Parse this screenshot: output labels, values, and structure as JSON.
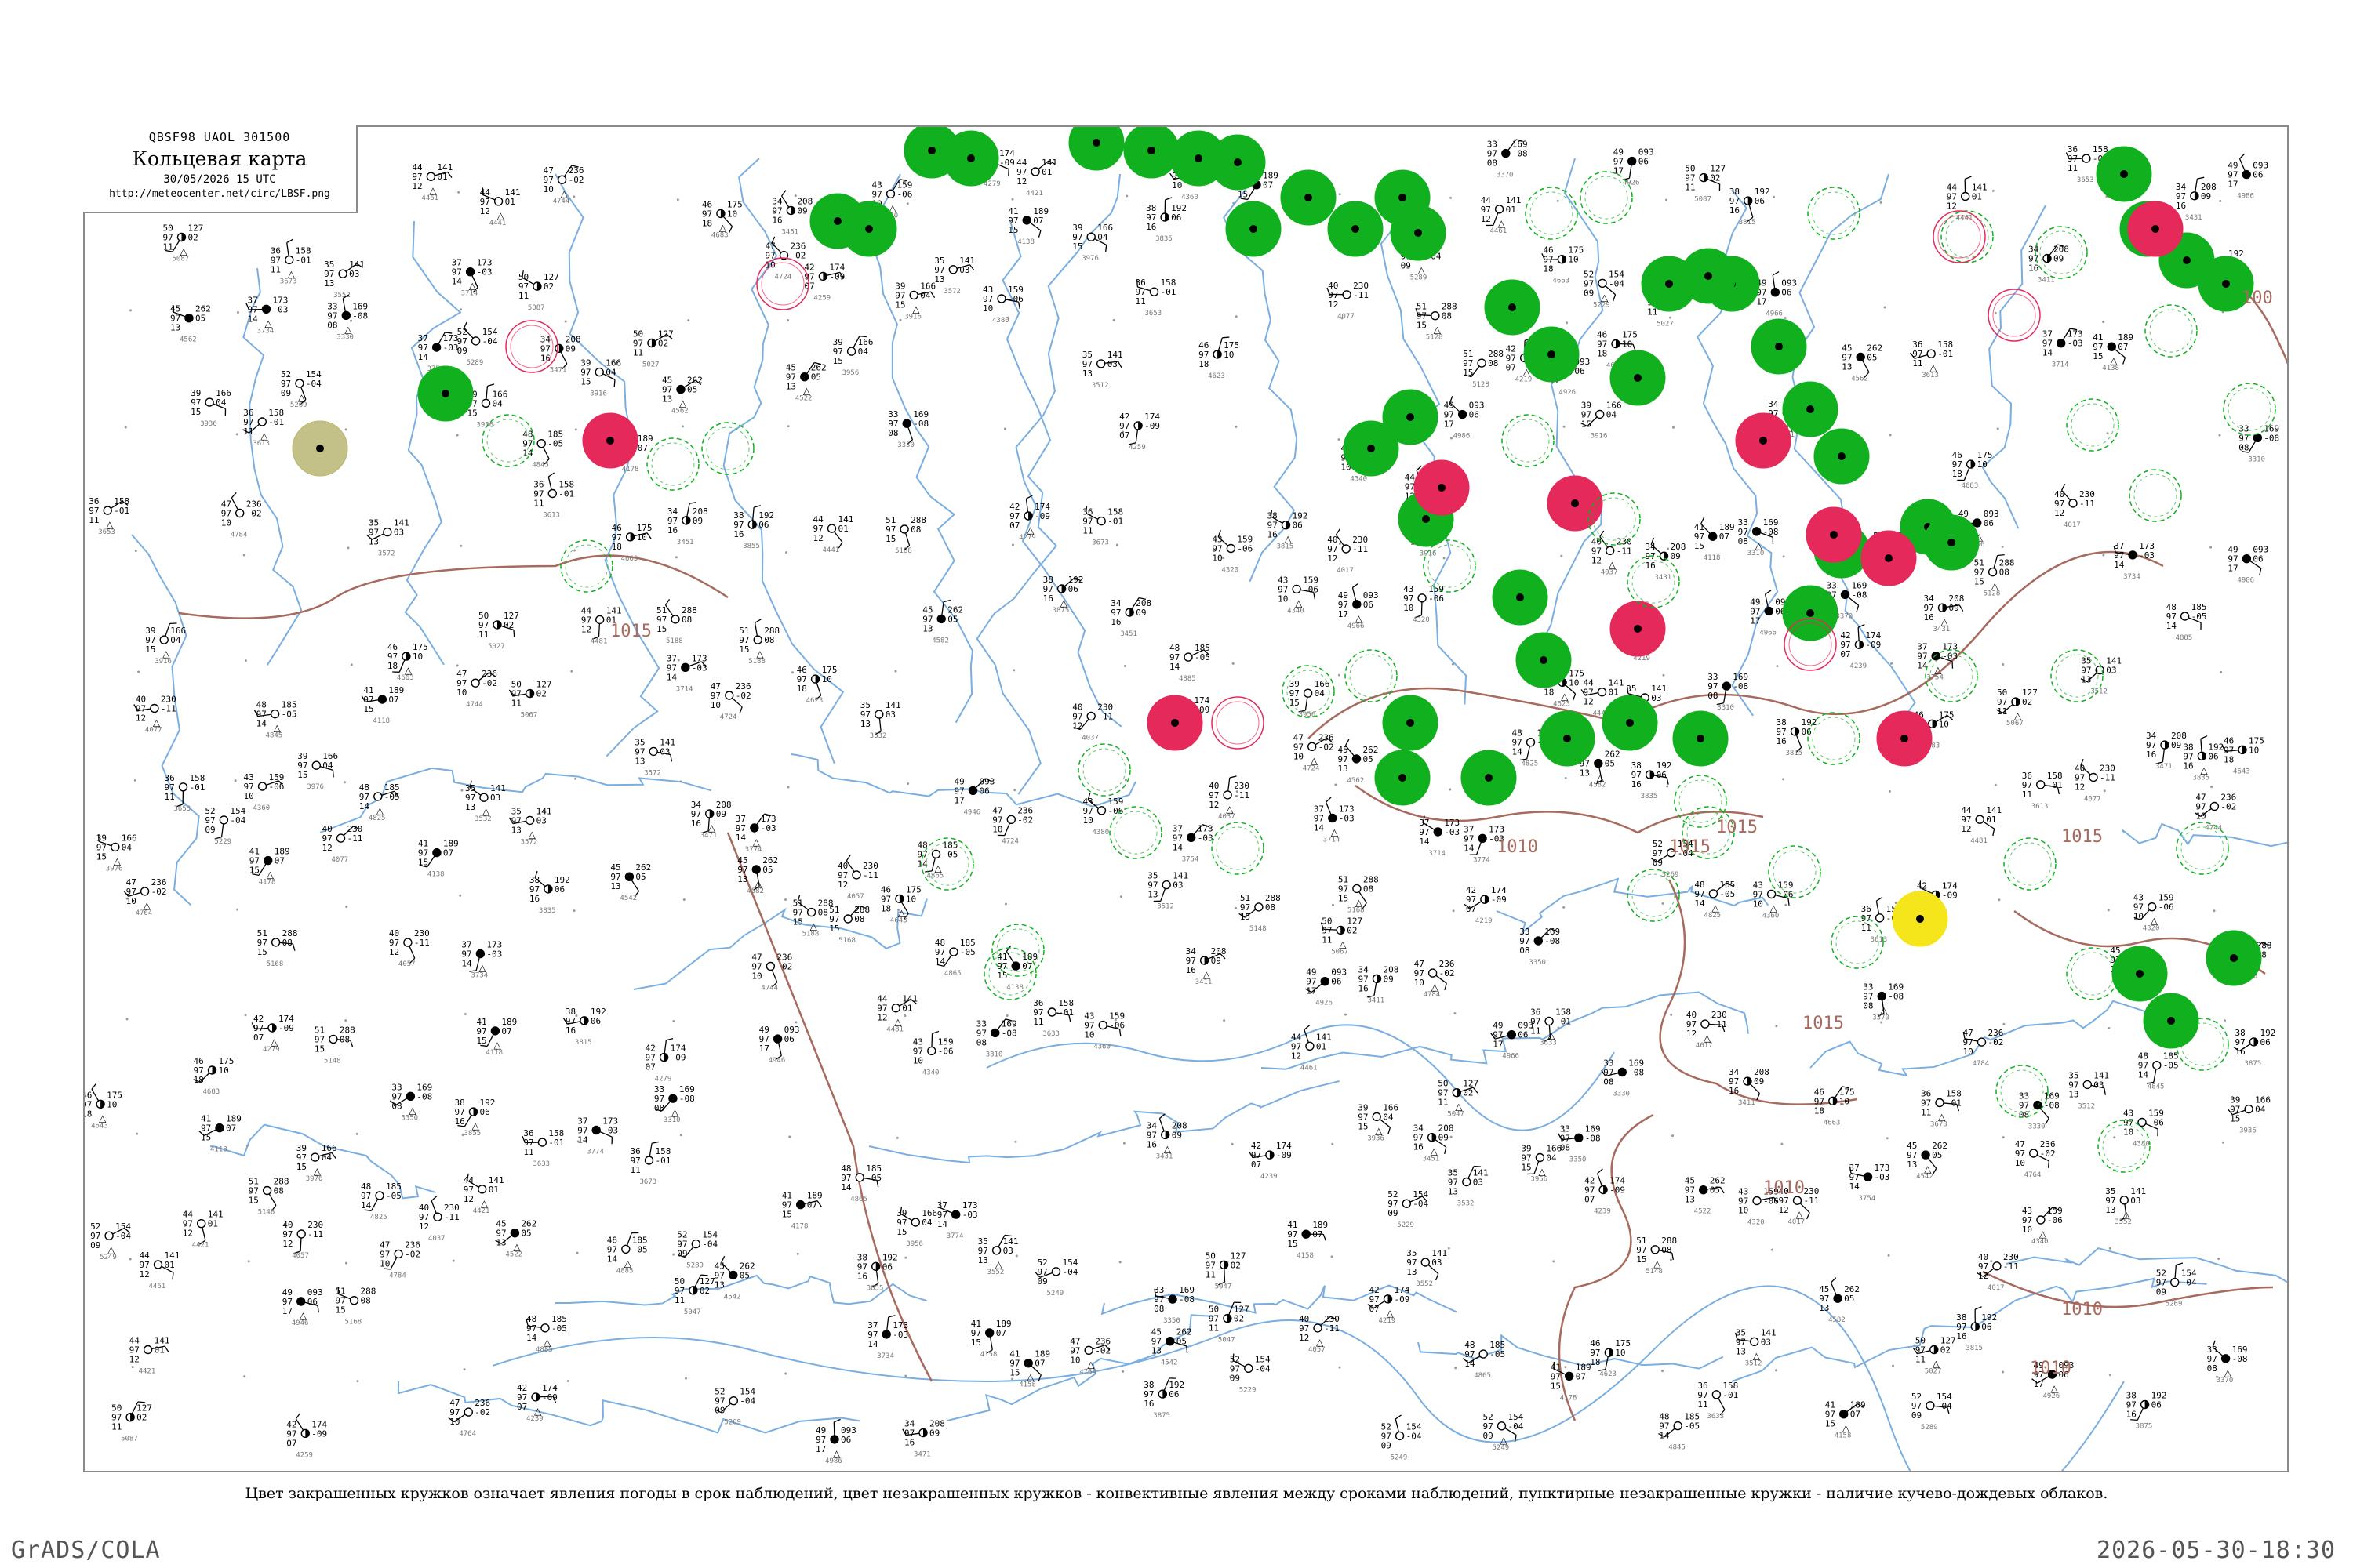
{
  "header": {
    "code_line": "QBSF98  UAOL  301500",
    "title": "Кольцевая карта",
    "datetime": "30/05/2026 15 UTC",
    "url": "http://meteocenter.net/circ/LBSF.png"
  },
  "caption": "Цвет закрашенных кружков означает явления погоды в срок наблюдений, цвет незакрашенных кружков - конвективные явления между сроками наблюдений, пунктирные незакрашенные кружки - наличие кучево-дождевых облаков.",
  "footer": {
    "software": "GrADS/COLA",
    "timestamp": "2026-05-30-18:30"
  },
  "colors": {
    "green": "#11b01f",
    "red": "#e5295a",
    "yellow": "#f5e51b",
    "olive": "#b9b673",
    "isobar": "#a86a5e",
    "water": "#7aaee0",
    "station": "#000000"
  },
  "isobar_labels": [
    "1015",
    "1010",
    "1015",
    "1015",
    "1010",
    "1015",
    "1010",
    "1015",
    "1010",
    "100"
  ],
  "stations": [
    {
      "id": "33",
      "p": "169",
      "t": "08",
      "d": "-08"
    },
    {
      "id": "34",
      "p": "208",
      "t": "16",
      "d": "09"
    },
    {
      "id": "35",
      "p": "141",
      "t": "13",
      "d": "03"
    },
    {
      "id": "36",
      "p": "158",
      "t": "11",
      "d": "-01"
    },
    {
      "id": "37",
      "p": "173",
      "t": "14",
      "d": "-03"
    },
    {
      "id": "38",
      "p": "192",
      "t": "16",
      "d": "06"
    },
    {
      "id": "39",
      "p": "166",
      "t": "15",
      "d": "04"
    },
    {
      "id": "40",
      "p": "230",
      "t": "12",
      "d": "-11"
    },
    {
      "id": "41",
      "p": "189",
      "t": "15",
      "d": "07"
    },
    {
      "id": "42",
      "p": "174",
      "t": "07",
      "d": "-09"
    },
    {
      "id": "43",
      "p": "159",
      "t": "10",
      "d": "-06"
    },
    {
      "id": "44",
      "p": "141",
      "t": "12",
      "d": "01"
    },
    {
      "id": "45",
      "p": "262",
      "t": "13",
      "d": "05"
    },
    {
      "id": "46",
      "p": "175",
      "t": "18",
      "d": "10"
    },
    {
      "id": "47",
      "p": "236",
      "t": "10",
      "d": "-02"
    },
    {
      "id": "48",
      "p": "185",
      "t": "14",
      "d": "-05"
    },
    {
      "id": "49",
      "p": "093",
      "t": "17",
      "d": "06"
    },
    {
      "id": "50",
      "p": "127",
      "t": "11",
      "d": "02"
    },
    {
      "id": "51",
      "p": "288",
      "t": "15",
      "d": "08"
    },
    {
      "id": "52",
      "p": "154",
      "t": "09",
      "d": "-04"
    }
  ]
}
